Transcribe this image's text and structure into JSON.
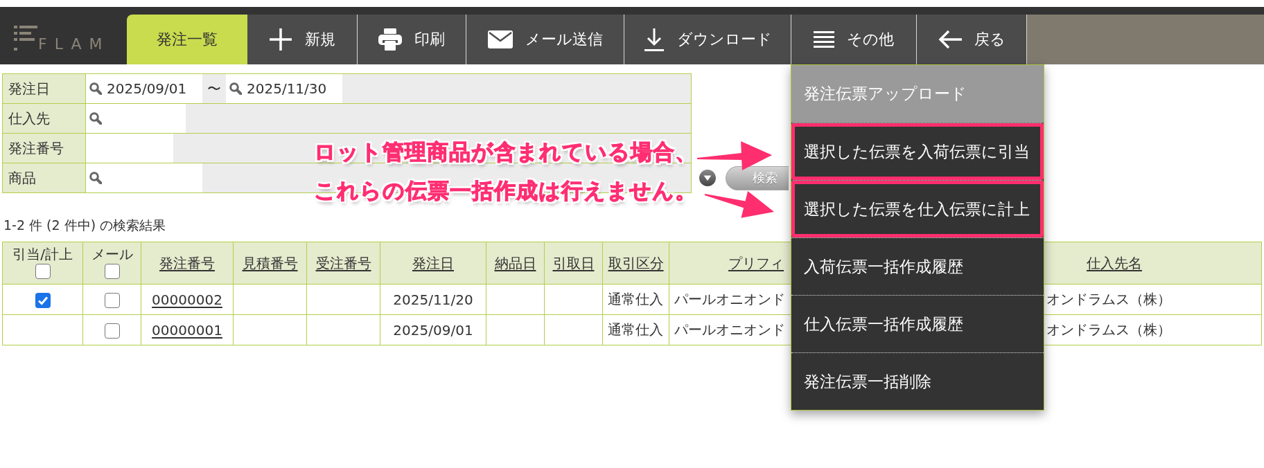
{
  "header": {
    "logo": "FLAM",
    "tabs": [
      {
        "label": "発注一覧",
        "selected": true
      }
    ],
    "buttons": [
      {
        "label": "新規"
      },
      {
        "label": "印刷"
      },
      {
        "label": "メール送信"
      },
      {
        "label": "ダウンロード"
      },
      {
        "label": "その他"
      },
      {
        "label": "戻る"
      }
    ]
  },
  "search_form": {
    "rows": [
      {
        "label": "発注日",
        "fields": [
          {
            "kind": "lookup",
            "value": "2025/09/01"
          },
          {
            "kind": "lookup",
            "value": "2025/11/30"
          }
        ],
        "separator": "〜"
      },
      {
        "label": "仕入先",
        "fields": [
          {
            "kind": "lookup"
          }
        ]
      },
      {
        "label": "発注番号",
        "fields": [
          {
            "kind": "text"
          }
        ]
      },
      {
        "label": "商品",
        "fields": [
          {
            "kind": "lookup"
          }
        ]
      }
    ],
    "search_button": "検索"
  },
  "result_summary": "1-2 件 (2 件中) の検索結果",
  "table": {
    "columns": [
      {
        "label": "引当/計上",
        "sortable": false,
        "checkbox": {
          "checked": false
        }
      },
      {
        "label": "メール",
        "sortable": false,
        "checkbox": {
          "checked": false
        }
      },
      {
        "label": "発注番号",
        "sortable": true
      },
      {
        "label": "見積番号",
        "sortable": true
      },
      {
        "label": "受注番号",
        "sortable": true
      },
      {
        "label": "発注日",
        "sortable": true
      },
      {
        "label": "納品日",
        "sortable": true
      },
      {
        "label": "引取日",
        "sortable": true
      },
      {
        "label": "取引区分",
        "sortable": true
      },
      {
        "label": "プリフィ",
        "sortable": true
      },
      {
        "label": "仕入先名",
        "sortable": true
      }
    ],
    "rows": [
      {
        "cells": [
          {
            "kind": "checkbox",
            "checked": true
          },
          {
            "kind": "checkbox",
            "checked": false
          },
          {
            "kind": "link",
            "text": "00000002"
          },
          null,
          null,
          {
            "kind": "text",
            "text": "2025/11/20"
          },
          null,
          null,
          {
            "kind": "text",
            "text": "通常仕入"
          },
          {
            "kind": "text",
            "text": "パールオニオンド"
          },
          {
            "kind": "text",
            "text": "オンドラムス（株）"
          }
        ]
      },
      {
        "cells": [
          null,
          {
            "kind": "checkbox",
            "checked": false
          },
          {
            "kind": "link",
            "text": "00000001"
          },
          null,
          null,
          {
            "kind": "text",
            "text": "2025/09/01"
          },
          null,
          null,
          {
            "kind": "text",
            "text": "通常仕入"
          },
          {
            "kind": "text",
            "text": "パールオニオンド"
          },
          {
            "kind": "text",
            "text": "オンドラムス（株）"
          }
        ]
      }
    ]
  },
  "dropdown_menu": {
    "items": [
      {
        "label": "発注伝票アップロード",
        "highlighted": true,
        "marked": false
      },
      {
        "label": "選択した伝票を入荷伝票に引当",
        "highlighted": false,
        "marked": true
      },
      {
        "label": "選択した伝票を仕入伝票に計上",
        "highlighted": false,
        "marked": true
      },
      {
        "label": "入荷伝票一括作成履歴",
        "highlighted": false,
        "marked": false
      },
      {
        "label": "仕入伝票一括作成履歴",
        "highlighted": false,
        "marked": false
      },
      {
        "label": "発注伝票一括削除",
        "highlighted": false,
        "marked": false
      }
    ]
  },
  "annotation": {
    "lines": [
      "ロット管理商品が含まれている場合、",
      "これらの伝票一括作成は行えません。"
    ]
  }
}
